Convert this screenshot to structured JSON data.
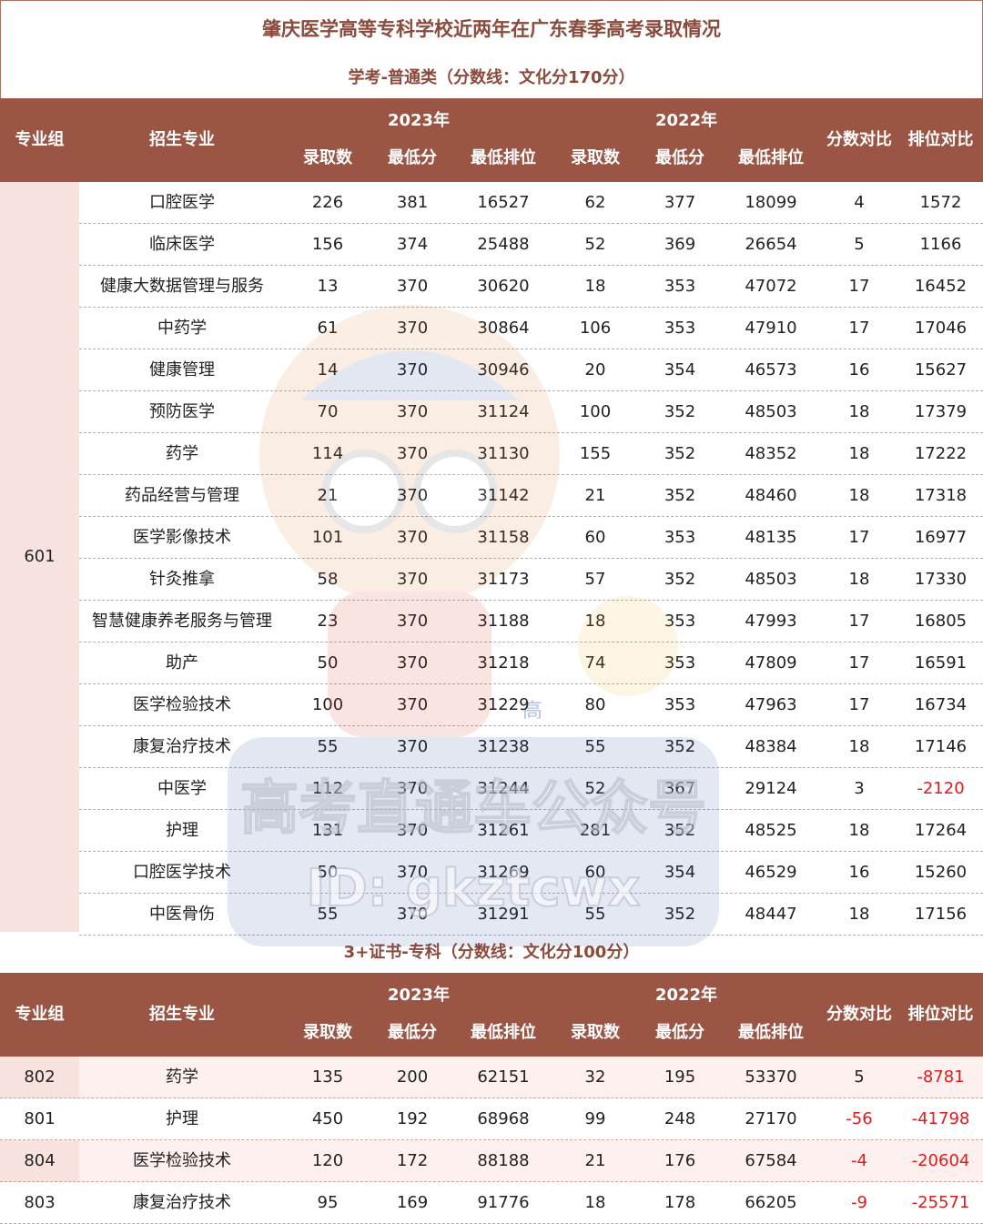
{
  "title": "肇庆医学高等专科学校近两年在广东春季高考录取情况",
  "section1": {
    "subtitle": "学考-普通类（分数线：文化分170分）",
    "header": {
      "group": "专业组",
      "major": "招生专业",
      "year_a": "2023年",
      "year_b": "2022年",
      "count": "录取数",
      "min_score": "最低分",
      "min_rank": "最低排位",
      "score_diff": "分数对比",
      "rank_diff": "排位对比"
    },
    "group": "601",
    "rows": [
      {
        "major": "口腔医学",
        "c23": "226",
        "s23": "381",
        "r23": "16527",
        "c22": "62",
        "s22": "377",
        "r22": "18099",
        "sd": "4",
        "rd": "1572"
      },
      {
        "major": "临床医学",
        "c23": "156",
        "s23": "374",
        "r23": "25488",
        "c22": "52",
        "s22": "369",
        "r22": "26654",
        "sd": "5",
        "rd": "1166"
      },
      {
        "major": "健康大数据管理与服务",
        "c23": "13",
        "s23": "370",
        "r23": "30620",
        "c22": "18",
        "s22": "353",
        "r22": "47072",
        "sd": "17",
        "rd": "16452"
      },
      {
        "major": "中药学",
        "c23": "61",
        "s23": "370",
        "r23": "30864",
        "c22": "106",
        "s22": "353",
        "r22": "47910",
        "sd": "17",
        "rd": "17046"
      },
      {
        "major": "健康管理",
        "c23": "14",
        "s23": "370",
        "r23": "30946",
        "c22": "20",
        "s22": "354",
        "r22": "46573",
        "sd": "16",
        "rd": "15627"
      },
      {
        "major": "预防医学",
        "c23": "70",
        "s23": "370",
        "r23": "31124",
        "c22": "100",
        "s22": "352",
        "r22": "48503",
        "sd": "18",
        "rd": "17379"
      },
      {
        "major": "药学",
        "c23": "114",
        "s23": "370",
        "r23": "31130",
        "c22": "155",
        "s22": "352",
        "r22": "48352",
        "sd": "18",
        "rd": "17222"
      },
      {
        "major": "药品经营与管理",
        "c23": "21",
        "s23": "370",
        "r23": "31142",
        "c22": "21",
        "s22": "352",
        "r22": "48460",
        "sd": "18",
        "rd": "17318"
      },
      {
        "major": "医学影像技术",
        "c23": "101",
        "s23": "370",
        "r23": "31158",
        "c22": "60",
        "s22": "353",
        "r22": "48135",
        "sd": "17",
        "rd": "16977"
      },
      {
        "major": "针灸推拿",
        "c23": "58",
        "s23": "370",
        "r23": "31173",
        "c22": "57",
        "s22": "352",
        "r22": "48503",
        "sd": "18",
        "rd": "17330"
      },
      {
        "major": "智慧健康养老服务与管理",
        "c23": "23",
        "s23": "370",
        "r23": "31188",
        "c22": "18",
        "s22": "353",
        "r22": "47993",
        "sd": "17",
        "rd": "16805"
      },
      {
        "major": "助产",
        "c23": "50",
        "s23": "370",
        "r23": "31218",
        "c22": "74",
        "s22": "353",
        "r22": "47809",
        "sd": "17",
        "rd": "16591"
      },
      {
        "major": "医学检验技术",
        "c23": "100",
        "s23": "370",
        "r23": "31229",
        "c22": "80",
        "s22": "353",
        "r22": "47963",
        "sd": "17",
        "rd": "16734"
      },
      {
        "major": "康复治疗技术",
        "c23": "55",
        "s23": "370",
        "r23": "31238",
        "c22": "55",
        "s22": "352",
        "r22": "48384",
        "sd": "18",
        "rd": "17146"
      },
      {
        "major": "中医学",
        "c23": "112",
        "s23": "370",
        "r23": "31244",
        "c22": "52",
        "s22": "367",
        "r22": "29124",
        "sd": "3",
        "rd": "-2120"
      },
      {
        "major": "护理",
        "c23": "131",
        "s23": "370",
        "r23": "31261",
        "c22": "281",
        "s22": "352",
        "r22": "48525",
        "sd": "18",
        "rd": "17264"
      },
      {
        "major": "口腔医学技术",
        "c23": "50",
        "s23": "370",
        "r23": "31269",
        "c22": "60",
        "s22": "354",
        "r22": "46529",
        "sd": "16",
        "rd": "15260"
      },
      {
        "major": "中医骨伤",
        "c23": "55",
        "s23": "370",
        "r23": "31291",
        "c22": "55",
        "s22": "352",
        "r22": "48447",
        "sd": "18",
        "rd": "17156"
      }
    ]
  },
  "section2": {
    "subtitle": "3+证书-专科（分数线：文化分100分）",
    "rows": [
      {
        "group": "802",
        "major": "药学",
        "c23": "135",
        "s23": "200",
        "r23": "62151",
        "c22": "32",
        "s22": "195",
        "r22": "53370",
        "sd": "5",
        "rd": "-8781"
      },
      {
        "group": "801",
        "major": "护理",
        "c23": "450",
        "s23": "192",
        "r23": "68968",
        "c22": "99",
        "s22": "248",
        "r22": "27170",
        "sd": "-56",
        "rd": "-41798"
      },
      {
        "group": "804",
        "major": "医学检验技术",
        "c23": "120",
        "s23": "172",
        "r23": "88188",
        "c22": "21",
        "s22": "176",
        "r22": "67584",
        "sd": "-4",
        "rd": "-20604"
      },
      {
        "group": "803",
        "major": "康复治疗技术",
        "c23": "95",
        "s23": "169",
        "r23": "91776",
        "c22": "18",
        "s22": "178",
        "r22": "66205",
        "sd": "-9",
        "rd": "-25571"
      }
    ]
  },
  "watermark": {
    "line1": "高考直通车公众号",
    "line2": "ID: gkztcwx",
    "badge": "高"
  },
  "colors": {
    "header_bg": "#9a5545",
    "title_text": "#8b4a3c",
    "group_bg": "#f8e2de",
    "negative": "#e01b1b"
  }
}
